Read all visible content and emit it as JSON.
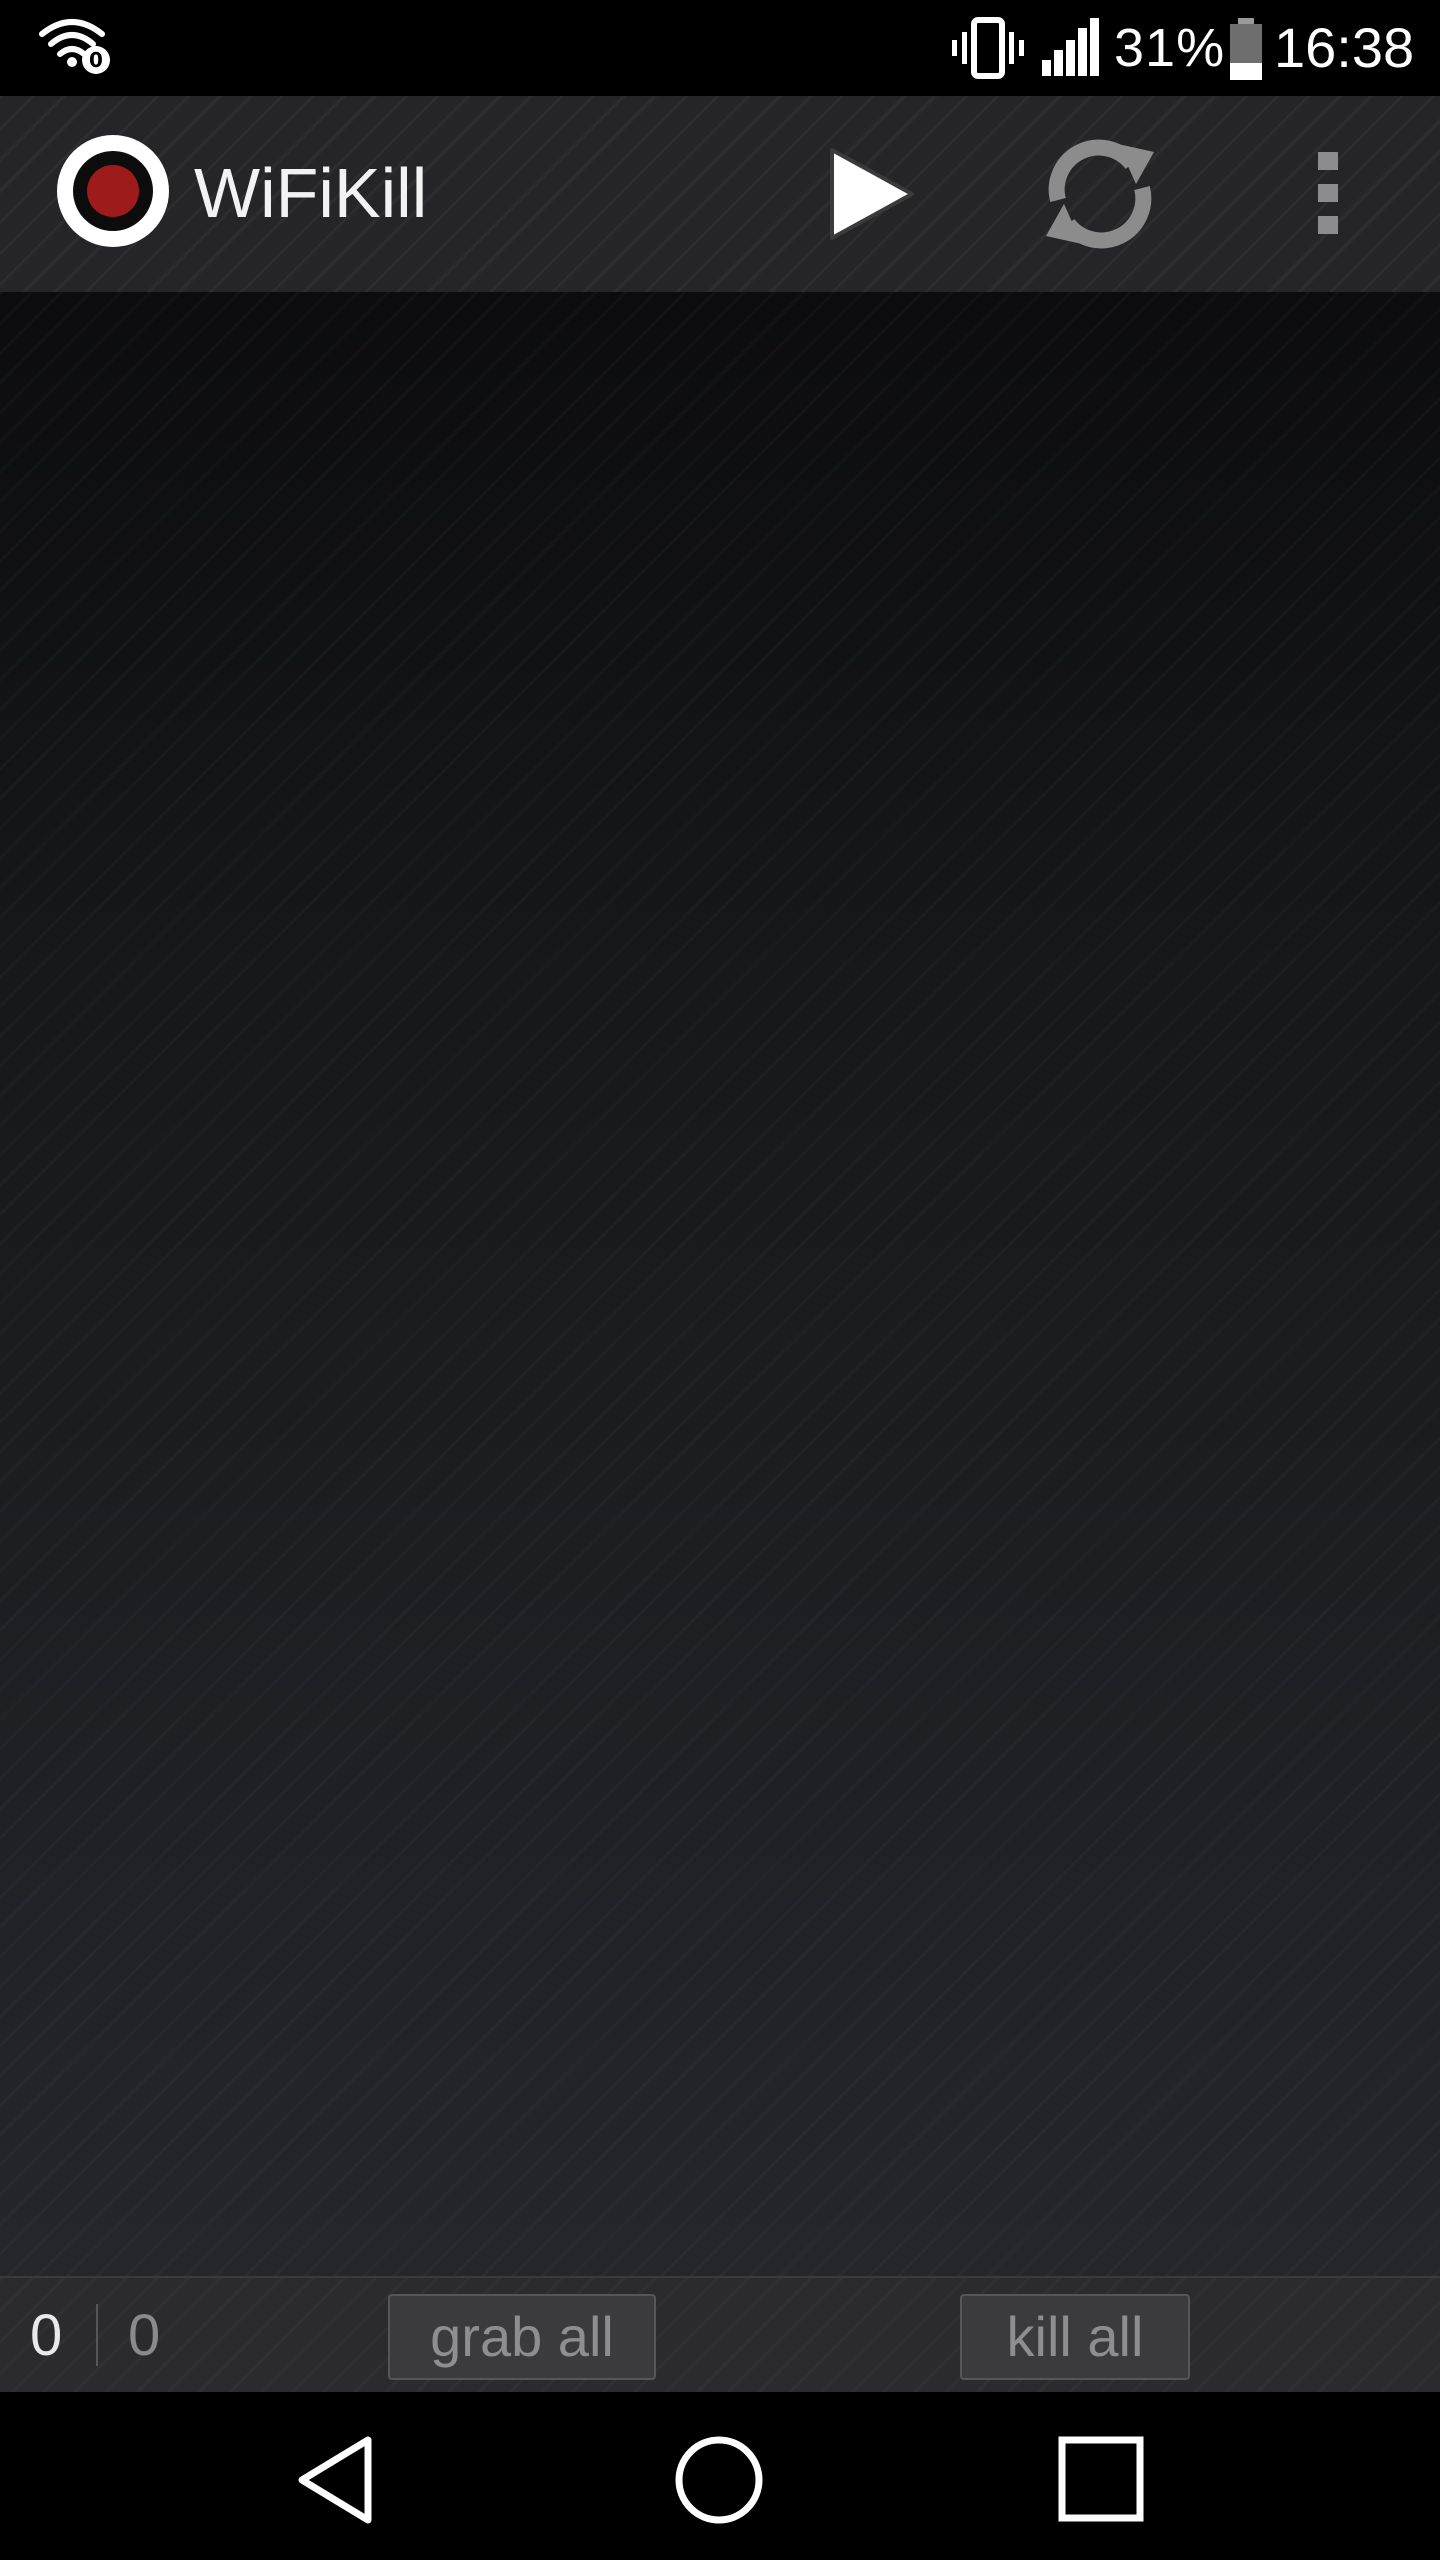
{
  "status_bar": {
    "wifi_icon": "wifi-icon",
    "vibrate_icon": "vibrate-icon",
    "signal_icon": "signal-icon",
    "battery_percent": "31%",
    "battery_level": 0.31,
    "battery_icon": "battery-icon",
    "time": "16:38"
  },
  "action_bar": {
    "logo_icon": "record-logo-icon",
    "title": "WiFiKill",
    "play_icon": "play-icon",
    "refresh_icon": "refresh-icon",
    "overflow_icon": "more-vert-icon"
  },
  "bottom_bar": {
    "count_left": "0",
    "count_right": "0",
    "grab_all_label": "grab all",
    "kill_all_label": "kill all"
  },
  "nav_bar": {
    "back_icon": "back-icon",
    "home_icon": "home-icon",
    "recents_icon": "recents-icon"
  },
  "colors": {
    "accent_red": "#9e1b1b",
    "background": "#18191c",
    "text_primary": "#f2f2f2",
    "text_muted": "#8e8e92"
  }
}
